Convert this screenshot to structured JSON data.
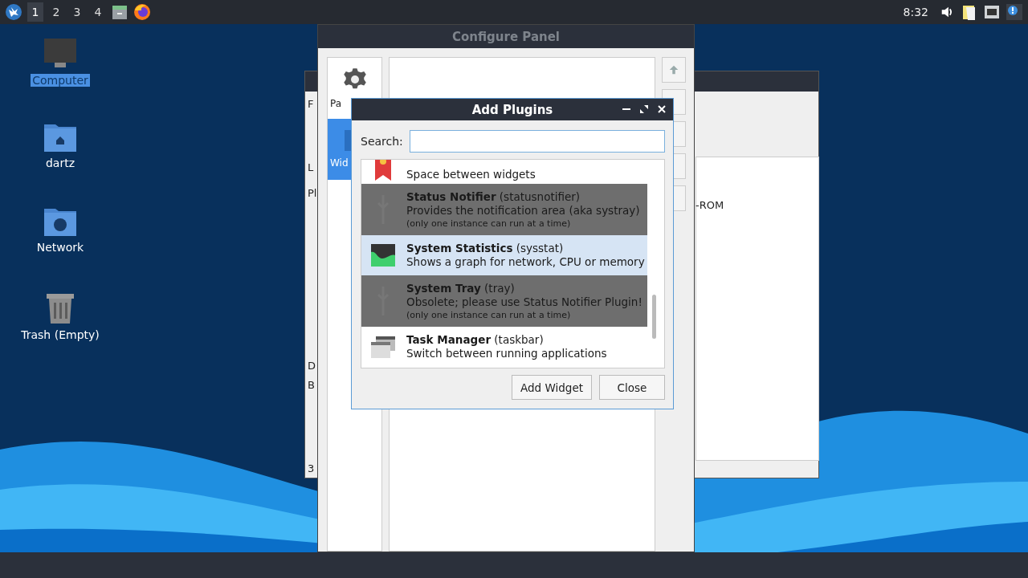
{
  "top_panel": {
    "workspaces": [
      {
        "label": "1",
        "selected": true
      },
      {
        "label": "2",
        "selected": false
      },
      {
        "label": "3",
        "selected": false
      },
      {
        "label": "4",
        "selected": false
      }
    ],
    "clock": "8:32"
  },
  "desktop_icons": [
    {
      "label": "Computer",
      "selected": true
    },
    {
      "label": "dartz",
      "selected": false
    },
    {
      "label": "Network",
      "selected": false
    },
    {
      "label": "Trash (Empty)",
      "selected": false
    }
  ],
  "background_window": {
    "fragments": [
      "F",
      "L",
      "Pl",
      "D",
      "B",
      "3",
      "-ROM"
    ]
  },
  "configure_panel": {
    "title": "Configure Panel",
    "sidebar": [
      {
        "label": "Pa",
        "selected": false
      },
      {
        "label": "Wid",
        "selected": true
      }
    ]
  },
  "add_plugins": {
    "title": "Add Plugins",
    "search": {
      "label": "Search:"
    },
    "plugins": [
      {
        "description": "Space between widgets",
        "disabled": false,
        "selected": false
      },
      {
        "name": "Status Notifier",
        "id": "(statusnotifier)",
        "description": "Provides the notification area (aka systray)",
        "note": "(only one instance can run at a time)",
        "disabled": true,
        "selected": false
      },
      {
        "name": "System Statistics",
        "id": "(sysstat)",
        "description": "Shows a graph for network, CPU or memory",
        "disabled": false,
        "selected": true
      },
      {
        "name": "System Tray",
        "id": "(tray)",
        "description": "Obsolete; please use Status Notifier Plugin!",
        "note": "(only one instance can run at a time)",
        "disabled": true,
        "selected": false
      },
      {
        "name": "Task Manager",
        "id": "(taskbar)",
        "description": "Switch between running applications",
        "disabled": false,
        "selected": false
      }
    ],
    "buttons": [
      "Add Widget",
      "Close"
    ]
  }
}
